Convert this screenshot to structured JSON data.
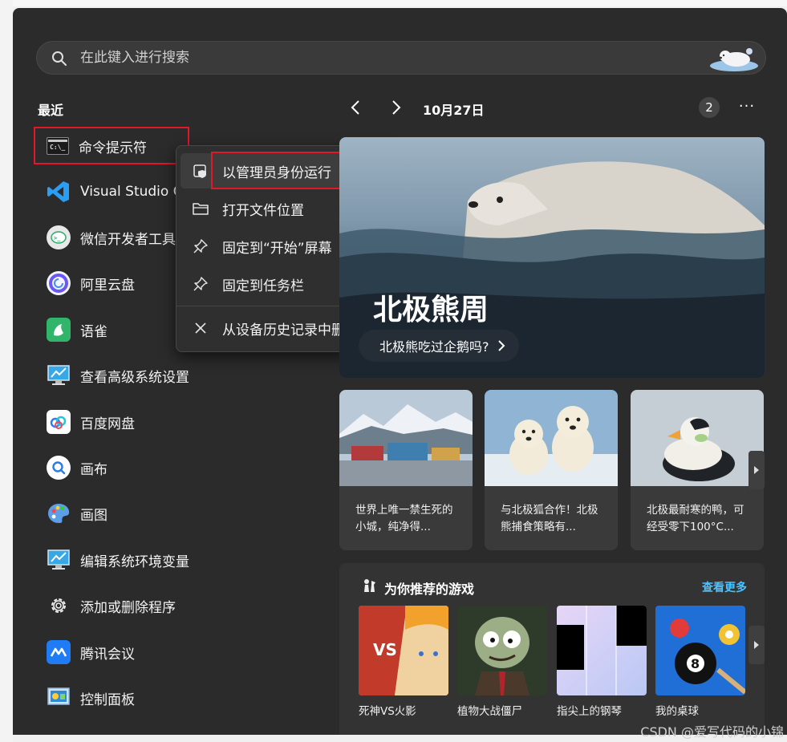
{
  "search": {
    "placeholder": "在此键入进行搜索"
  },
  "recent": {
    "title": "最近",
    "items": [
      {
        "label": "命令提示符",
        "icon": "cmd-icon"
      },
      {
        "label": "Visual Studio Code",
        "icon": "vscode-icon"
      },
      {
        "label": "微信开发者工具",
        "icon": "wechat-devtools-icon"
      },
      {
        "label": "阿里云盘",
        "icon": "aliyun-drive-icon"
      },
      {
        "label": "语雀",
        "icon": "yuque-icon"
      },
      {
        "label": "查看高级系统设置",
        "icon": "system-settings-icon"
      },
      {
        "label": "百度网盘",
        "icon": "baidu-netdisk-icon"
      },
      {
        "label": "画布",
        "icon": "canvas-icon"
      },
      {
        "label": "画图",
        "icon": "paint-icon"
      },
      {
        "label": "编辑系统环境变量",
        "icon": "env-vars-icon"
      },
      {
        "label": "添加或删除程序",
        "icon": "gear-icon"
      },
      {
        "label": "腾讯会议",
        "icon": "tencent-meeting-icon"
      },
      {
        "label": "控制面板",
        "icon": "control-panel-icon"
      }
    ]
  },
  "context_menu": {
    "items": [
      {
        "label": "以管理员身份运行",
        "icon": "admin-shield-icon"
      },
      {
        "label": "打开文件位置",
        "icon": "folder-icon"
      },
      {
        "label": "固定到“开始”屏幕",
        "icon": "pin-icon"
      },
      {
        "label": "固定到任务栏",
        "icon": "pin-icon"
      },
      {
        "label": "从设备历史记录中删除",
        "icon": "close-icon"
      }
    ]
  },
  "feed": {
    "date": "10月27日",
    "badge": "2",
    "more": "···",
    "hero": {
      "title": "北极熊周",
      "subtitle": "北极熊吃过企鹅吗?"
    },
    "cards": [
      {
        "text": "世界上唯一禁生死的小城，纯净得..."
      },
      {
        "text": "与北极狐合作！北极熊捕食策略有..."
      },
      {
        "text": "北极最耐寒的鸭，可经受零下100°C..."
      }
    ]
  },
  "games": {
    "title": "为你推荐的游戏",
    "see_more": "查看更多",
    "items": [
      {
        "label": "死神VS火影"
      },
      {
        "label": "植物大战僵尸"
      },
      {
        "label": "指尖上的钢琴"
      },
      {
        "label": "我的桌球"
      }
    ]
  },
  "colors": {
    "panel": "#2b2b2b",
    "accent_link": "#4cc2ff",
    "highlight_box": "#e0182a"
  },
  "watermark": "CSDN @爱写代码的小锦"
}
